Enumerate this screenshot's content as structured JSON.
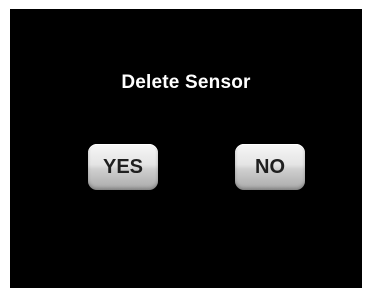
{
  "dialog": {
    "title": "Delete Sensor",
    "yes_label": "YES",
    "no_label": "NO"
  },
  "colors": {
    "screen_background": "#000000",
    "text": "#ffffff",
    "button_text": "#1f1f1f"
  }
}
